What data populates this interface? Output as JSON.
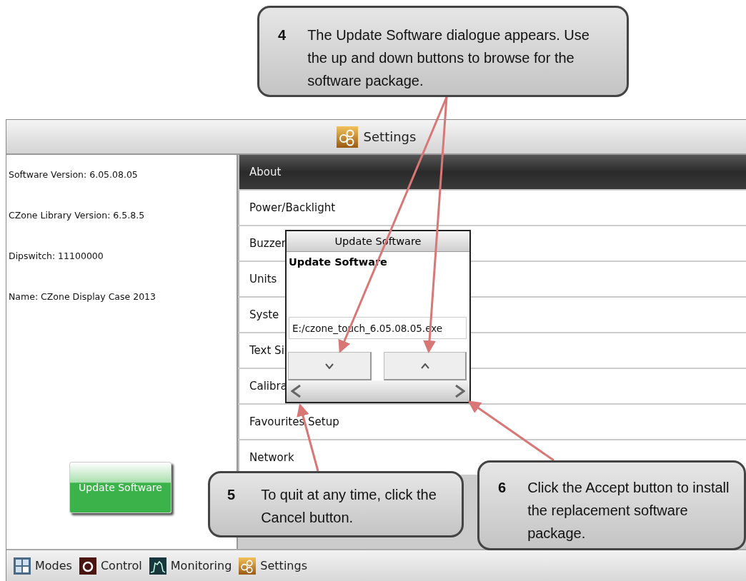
{
  "callouts": [
    {
      "number": "4",
      "text": "The Update Software dialogue appears. Use the up and down buttons to browse for the software package."
    },
    {
      "number": "5",
      "text": "To quit at any time, click the Cancel button."
    },
    {
      "number": "6",
      "text": "Click the Accept button to install the replacement software package."
    }
  ],
  "header": {
    "title": "Settings"
  },
  "info": [
    "Software Version: 6.05.08.05",
    "CZone Library Version: 6.5.8.5",
    "Dipswitch: 11100000",
    "Name: CZone Display Case 2013"
  ],
  "update_button": "Update Software",
  "menu": [
    {
      "label": "About",
      "selected": true
    },
    {
      "label": "Power/Backlight",
      "selected": false
    },
    {
      "label": "Buzzer",
      "selected": false
    },
    {
      "label": "Units",
      "selected": false
    },
    {
      "label": "Syste",
      "selected": false
    },
    {
      "label": "Text Si",
      "selected": false
    },
    {
      "label": "Calibra",
      "selected": false
    },
    {
      "label": "Favourites Setup",
      "selected": false
    },
    {
      "label": "Network",
      "selected": false
    }
  ],
  "dialog": {
    "title": "Update Software",
    "heading": "Update Software",
    "file": "E:/czone_touch_6.05.08.05.exe"
  },
  "taskbar": [
    {
      "kind": "modes",
      "label": "Modes"
    },
    {
      "kind": "control",
      "label": "Control"
    },
    {
      "kind": "monitoring",
      "label": "Monitoring"
    },
    {
      "kind": "settings",
      "label": "Settings"
    }
  ]
}
